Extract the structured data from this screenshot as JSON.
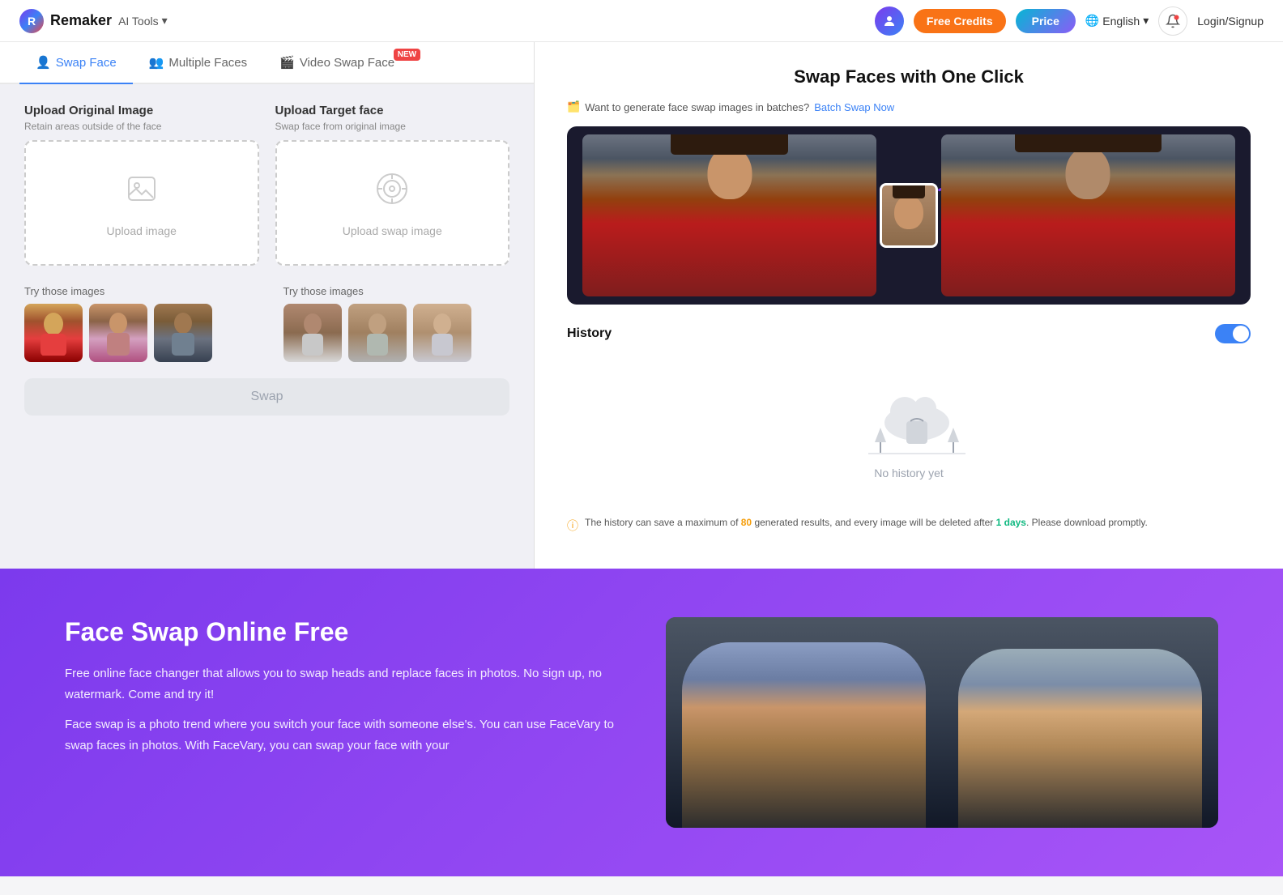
{
  "header": {
    "logo_text": "Remaker",
    "ai_tools_label": "AI Tools",
    "btn_free_credits": "Free Credits",
    "btn_price": "Price",
    "lang_label": "English",
    "btn_login": "Login/Signup"
  },
  "tabs": [
    {
      "id": "swap-face",
      "label": "Swap Face",
      "active": true,
      "new": false
    },
    {
      "id": "multiple-faces",
      "label": "Multiple Faces",
      "active": false,
      "new": false
    },
    {
      "id": "video-swap-face",
      "label": "Video Swap Face",
      "active": false,
      "new": true
    }
  ],
  "upload_original": {
    "label": "Upload Original Image",
    "sublabel": "Retain areas outside of the face",
    "box_text": "Upload image"
  },
  "upload_target": {
    "label": "Upload Target face",
    "sublabel": "Swap face from original image",
    "box_text": "Upload swap image"
  },
  "try_images_label": "Try those images",
  "swap_button": "Swap",
  "right_panel": {
    "title": "Swap Faces with One Click",
    "batch_text": "Want to generate face swap images in batches?",
    "batch_link": "Batch Swap Now"
  },
  "history": {
    "title": "History",
    "toggle_on": true,
    "empty_text": "No history yet",
    "note_before": "The history can save a maximum of ",
    "note_count": "80",
    "note_middle": " generated results, and every image will be deleted after ",
    "note_days": "1 days",
    "note_after": ". Please download promptly."
  },
  "promo": {
    "title": "Face Swap Online Free",
    "para1": "Free online face changer that allows you to swap heads and replace faces in photos. No sign up, no watermark. Come and try it!",
    "para2": "Face swap is a photo trend where you switch your face with someone else's. You can use FaceVary to swap faces in photos. With FaceVary, you can swap your face with your"
  }
}
